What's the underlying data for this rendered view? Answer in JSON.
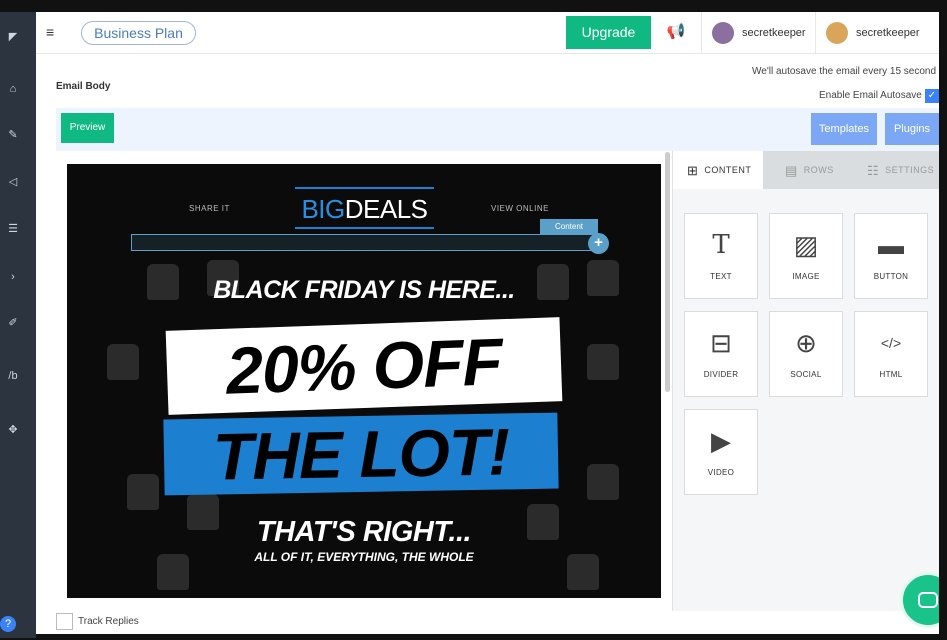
{
  "header": {
    "plan_label": "Business Plan",
    "upgrade_label": "Upgrade",
    "users": [
      {
        "name": "secretkeeper",
        "avatar_color": "#8b6f9e"
      },
      {
        "name": "secretkeeper",
        "avatar_color": "#d9a55b"
      }
    ]
  },
  "editor": {
    "autosave_note": "We'll autosave the email every 15 second",
    "section_label": "Email Body",
    "autosave_toggle_label": "Enable Email Autosave",
    "autosave_enabled": true,
    "preview_label": "Preview",
    "templates_label": "Templates",
    "plugins_label": "Plugins"
  },
  "email": {
    "share_it": "SHARE IT",
    "logo_big": "BIG",
    "logo_deals": "DEALS",
    "view_online": "VIEW ONLINE",
    "content_tag": "Content",
    "headline": "BLACK FRIDAY IS HERE...",
    "offer": "20% OFF",
    "offer_line2": "THE LOT!",
    "tagline": "THAT'S RIGHT...",
    "subtagline": "ALL OF IT, EVERYTHING, THE WHOLE"
  },
  "panel": {
    "tabs": [
      {
        "label": "CONTENT",
        "icon": "grid-icon",
        "active": true
      },
      {
        "label": "ROWS",
        "icon": "rows-icon",
        "active": false
      },
      {
        "label": "SETTINGS",
        "icon": "settings-icon",
        "active": false
      }
    ],
    "blocks": [
      {
        "label": "TEXT",
        "icon": "text-icon"
      },
      {
        "label": "IMAGE",
        "icon": "image-icon"
      },
      {
        "label": "BUTTON",
        "icon": "button-icon"
      },
      {
        "label": "DIVIDER",
        "icon": "divider-icon"
      },
      {
        "label": "SOCIAL",
        "icon": "social-icon"
      },
      {
        "label": "HTML",
        "icon": "html-icon"
      },
      {
        "label": "VIDEO",
        "icon": "video-icon"
      }
    ]
  },
  "footer": {
    "track_replies_label": "Track Replies"
  }
}
